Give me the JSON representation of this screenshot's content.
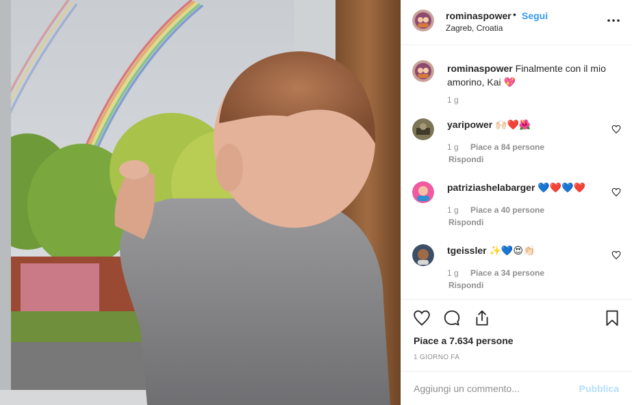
{
  "header": {
    "username": "rominaspower",
    "separator": "•",
    "follow_label": "Segui",
    "location": "Zagreb, Croatia"
  },
  "caption": {
    "username": "rominaspower",
    "text": "Finalmente con il mio amorino, Kai 💖",
    "time": "1 g"
  },
  "comments": [
    {
      "username": "yaripower",
      "text": "🙌🏻❤️🌺",
      "time": "1 g",
      "likes": "Piace a 84 persone",
      "reply_label": "Rispondi"
    },
    {
      "username": "patriziashelabarger",
      "text": "💙❤️💙❤️",
      "time": "1 g",
      "likes": "Piace a 40 persone",
      "reply_label": "Rispondi"
    },
    {
      "username": "tgeissler",
      "text": "✨💙😍👏🏻",
      "time": "1 g",
      "likes": "Piace a 34 persone",
      "reply_label": "Rispondi"
    }
  ],
  "actions": {
    "likes_label": "Piace a 7.634 persone",
    "time_ago": "1 GIORNO FA",
    "icons": [
      "heart-icon",
      "comment-icon",
      "share-icon",
      "bookmark-icon"
    ]
  },
  "add_comment": {
    "placeholder": "Aggiungi un commento...",
    "publish_label": "Pubblica"
  },
  "colors": {
    "link_blue": "#3897f0",
    "publish_disabled": "#b2dffc",
    "muted_text": "#8e8e8e",
    "border": "#efefef"
  }
}
